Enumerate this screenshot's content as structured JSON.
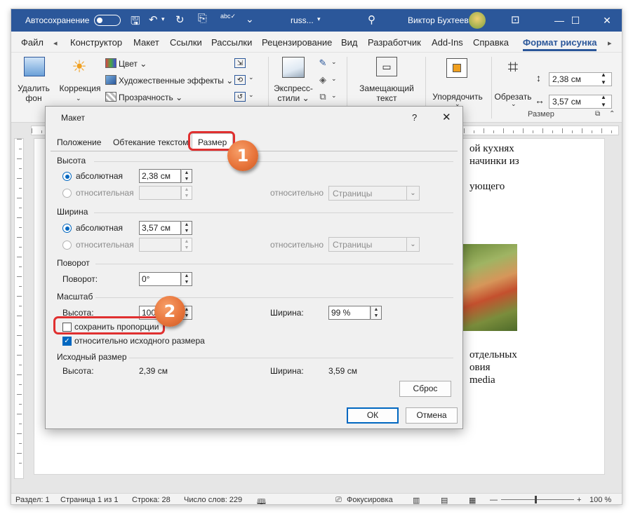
{
  "titlebar": {
    "autosave_label": "Автосохранение",
    "doc_name": "russ...",
    "user_name": "Виктор Бухтеев",
    "bg_color": "#2b579a"
  },
  "menu": {
    "tabs": [
      "Файл",
      "Конструктор",
      "Макет",
      "Ссылки",
      "Рассылки",
      "Рецензирование",
      "Вид",
      "Разработчик",
      "Add-Ins",
      "Справка",
      "Формат рисунка"
    ],
    "active_tab": "Формат рисунка"
  },
  "ribbon": {
    "remove_bg": [
      "Удалить",
      "фон"
    ],
    "corrections": "Коррекция",
    "color": "Цвет",
    "artistic_effects": "Художественные эффекты",
    "transparency": "Прозрачность",
    "express_styles": [
      "Экспресс-",
      "стили"
    ],
    "alt_text": [
      "Замещающий",
      "текст"
    ],
    "arrange": "Упорядочить",
    "crop": "Обрезать",
    "height_value": "2,38 см",
    "width_value": "3,57 см",
    "size_group": "Размер"
  },
  "document": {
    "lines": [
      "ой кухнях",
      "начинки из",
      "ующего",
      "отдельных",
      "овия",
      "media"
    ]
  },
  "dialog": {
    "title": "Макет",
    "help": "?",
    "close": "✕",
    "tabs": [
      "Положение",
      "Обтекание текстом",
      "Размер"
    ],
    "active_tab": "Размер",
    "height": {
      "section": "Высота",
      "absolute_label": "абсолютная",
      "absolute_value": "2,38 см",
      "relative_label": "относительная",
      "relative_to_label": "относительно",
      "relative_to_value": "Страницы"
    },
    "width": {
      "section": "Ширина",
      "absolute_label": "абсолютная",
      "absolute_value": "3,57 см",
      "relative_label": "относительная",
      "relative_to_label": "относительно",
      "relative_to_value": "Страницы"
    },
    "rotation": {
      "section": "Поворот",
      "label": "Поворот:",
      "value": "0°"
    },
    "scale": {
      "section": "Масштаб",
      "height_label": "Высота:",
      "height_value": "100 %",
      "width_label": "Ширина:",
      "width_value": "99 %",
      "lock_aspect": "сохранить пропорции",
      "lock_aspect_checked": false,
      "relative_original": "относительно исходного размера",
      "relative_original_checked": true
    },
    "original": {
      "section": "Исходный размер",
      "height_label": "Высота:",
      "height_value": "2,39 см",
      "width_label": "Ширина:",
      "width_value": "3,59 см"
    },
    "reset": "Сброс",
    "ok": "ОК",
    "cancel": "Отмена"
  },
  "annotations": {
    "badge1": "1",
    "badge2": "2",
    "highlight_color": "#e03030",
    "badge_color": "#e8753b"
  },
  "statusbar": {
    "section": "Раздел: 1",
    "page": "Страница 1 из 1",
    "line": "Строка: 28",
    "words": "Число слов: 229",
    "focus": "Фокусировка",
    "zoom": "100 %"
  }
}
